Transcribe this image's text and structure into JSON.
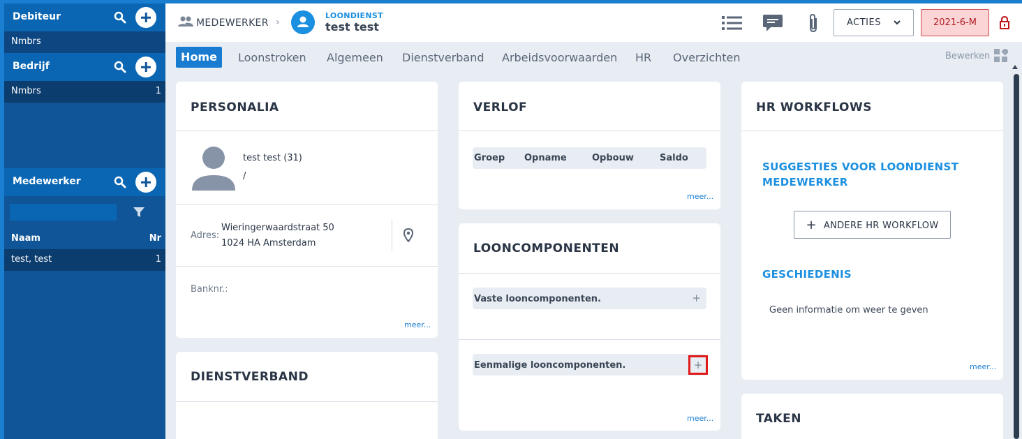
{
  "sidebar": {
    "debiteur": {
      "title": "Debiteur",
      "item": "Nmbrs"
    },
    "bedrijf": {
      "title": "Bedrijf",
      "item": "Nmbrs",
      "item_count": "1"
    },
    "medewerker": {
      "title": "Medewerker",
      "filter_value": "",
      "col_name": "Naam",
      "col_nr": "Nr",
      "rows": [
        {
          "name": "test, test",
          "nr": "1"
        }
      ]
    }
  },
  "topbar": {
    "breadcrumb_label": "MEDEWERKER",
    "company_label": "LOONDIENST",
    "employee_name": "test test",
    "acties_label": "ACTIES",
    "period_label": "2021-6-M"
  },
  "tabs": [
    "Home",
    "Loonstroken",
    "Algemeen",
    "Dienstverband",
    "Arbeidsvoorwaarden",
    "HR",
    "Overzichten"
  ],
  "edit_label": "Bewerken",
  "personalia": {
    "title": "PERSONALIA",
    "name_age": "test test (31)",
    "slash": "/",
    "address_label": "Adres:",
    "address_line1": "Wieringerwaardstraat 50",
    "address_line2": "1024 HA Amsterdam",
    "bank_label": "Banknr.:",
    "more": "meer..."
  },
  "dienstverband": {
    "title": "DIENSTVERBAND"
  },
  "verlof": {
    "title": "VERLOF",
    "columns": [
      "Groep",
      "Opname",
      "Opbouw",
      "Saldo"
    ],
    "more": "meer..."
  },
  "looncomponenten": {
    "title": "LOONCOMPONENTEN",
    "vaste": "Vaste looncomponenten.",
    "eenmalige": "Eenmalige looncomponenten.",
    "plus": "+",
    "more": "meer..."
  },
  "hr_workflows": {
    "title": "HR WORKFLOWS",
    "suggest_line1": "SUGGESTIES VOOR LOONDIENST",
    "suggest_line2": "MEDEWERKER",
    "btn_plus": "+",
    "btn_label": "ANDERE HR WORKFLOW",
    "history_title": "GESCHIEDENIS",
    "empty": "Geen informatie om weer te geven",
    "more": "meer..."
  },
  "taken": {
    "title": "TAKEN"
  },
  "colors": {
    "accent": "#1b7fd1",
    "sidebar": "#0f5597",
    "period_bg": "#fbd4d6",
    "period_text": "#b01c22",
    "highlight": "#e01919"
  }
}
